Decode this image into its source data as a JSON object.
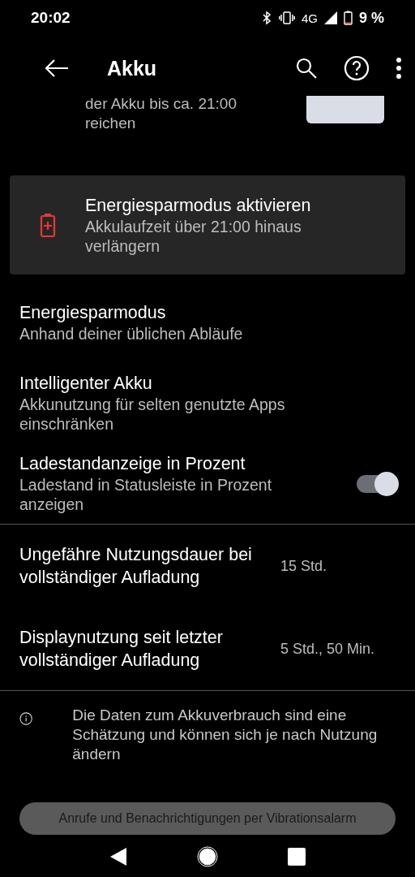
{
  "status_bar": {
    "time": "20:02",
    "network": "4G",
    "battery": "9 %"
  },
  "toolbar": {
    "title": "Akku"
  },
  "summary": {
    "lines": [
      "der Akku bis ca. 21:00",
      "reichen"
    ]
  },
  "saver_card": {
    "title": "Energiesparmodus aktivieren",
    "subtitle": "Akkulaufzeit über 21:00 hinaus verlängern"
  },
  "settings": [
    {
      "kind": "plain",
      "title": "Energiesparmodus",
      "subtitle": "Anhand deiner üblichen Abläufe"
    },
    {
      "kind": "plain",
      "title": "Intelligenter Akku",
      "subtitle": "Akkunutzung für selten genutzte Apps einschränken"
    },
    {
      "kind": "switch",
      "title": "Ladestandanzeige in Prozent",
      "subtitle": "Ladestand in Statusleiste in Prozent anzeigen",
      "on": true
    }
  ],
  "stats": [
    {
      "title": "Ungefähre Nutzungsdauer bei vollständiger Aufladung",
      "value": "15 Std."
    },
    {
      "title": "Displaynutzung seit letzter vollständiger Aufladung",
      "value": "5 Std., 50 Min."
    }
  ],
  "footer_note": "Die Daten zum Akkuverbrauch sind eine Schätzung und können sich je nach Nutzung ändern",
  "toast": "Anrufe und Benachrichtigungen per Vibrationsalarm"
}
